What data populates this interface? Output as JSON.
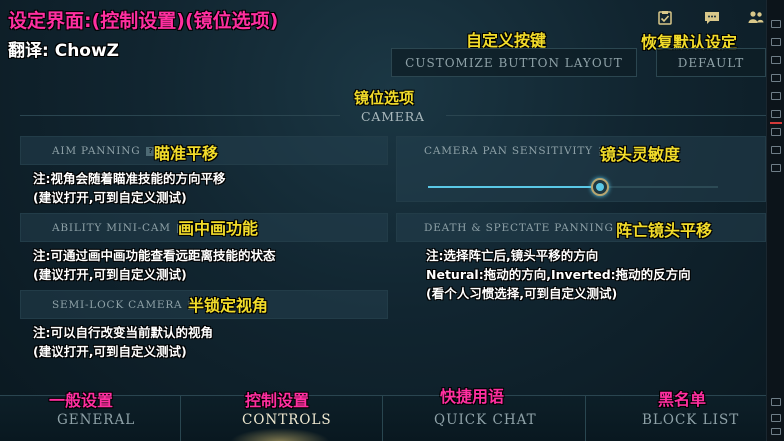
{
  "overlay": {
    "title": "设定界面:(控制设置)(镜位选项)",
    "translator": "翻译: ChowZ",
    "custom_buttons_zh": "自定义按键",
    "default_zh": "恢复默认设定",
    "camera_zh": "镜位选项",
    "aim_zh": "瞄准平移",
    "aim_note1": "注:视角会随着瞄准技能的方向平移",
    "aim_note2": "(建议打开,可到自定义测试)",
    "minicam_zh": "画中画功能",
    "minicam_note1": "注:可通过画中画功能查看远距离技能的状态",
    "minicam_note2": "(建议打开,可到自定义测试)",
    "semilock_zh": "半锁定视角",
    "semilock_note1": "注:可以自行改变当前默认的视角",
    "semilock_note2": "(建议打开,可到自定义测试)",
    "sensitivity_zh": "镜头灵敏度",
    "death_zh": "阵亡镜头平移",
    "death_note1": "注:选择阵亡后,镜头平移的方向",
    "death_note2": "Netural:拖动的方向,Inverted:拖动的反方向",
    "death_note3": "(看个人习惯选择,可到自定义测试)",
    "nav_general_zh": "一般设置",
    "nav_controls_zh": "控制设置",
    "nav_quickchat_zh": "快捷用语",
    "nav_blocklist_zh": "黑名单"
  },
  "header": {
    "customize_label": "CUSTOMIZE BUTTON LAYOUT",
    "default_label": "DEFAULT"
  },
  "section": {
    "camera_label": "CAMERA"
  },
  "settings": {
    "aim_panning": "AIM PANNING",
    "ability_minicam": "ABILITY MINI-CAM",
    "semi_lock": "SEMI-LOCK CAMERA",
    "pan_sensitivity": "CAMERA PAN SENSITIVITY",
    "death_panning": "DEATH & SPECTATE PANNING",
    "help_glyph": "?",
    "sensitivity_value": 0.6
  },
  "nav": {
    "general": "GENERAL",
    "controls": "CONTROLS",
    "quick_chat": "QUICK CHAT",
    "block_list": "BLOCK LIST",
    "active": "controls"
  },
  "colors": {
    "overlay_yellow": "#f2dc2a",
    "overlay_pink": "#ff2fa0",
    "accent_cyan": "#5ac8e6"
  },
  "icons": [
    "clipboard-check-icon",
    "chat-bubble-icon",
    "friends-icon"
  ]
}
